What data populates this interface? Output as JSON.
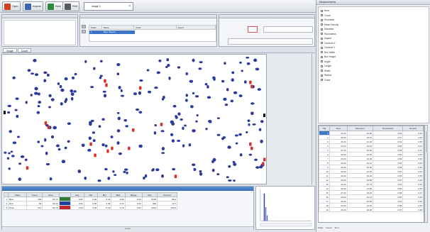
{
  "toolbar": {
    "buttons": [
      {
        "label": "Open",
        "color": "#d04020"
      },
      {
        "label": "Acquire",
        "color": "#3a66b0"
      },
      {
        "label": "Save",
        "color": "#2e8b3a"
      },
      {
        "label": "Print",
        "color": "#5a5a5a"
      }
    ],
    "document_tab": "Image 1",
    "close_glyph": "×"
  },
  "image_tabs": [
    "Image",
    "Count"
  ],
  "right_panel": {
    "header": "Measurements",
    "items": [
      "Area",
      "Count",
      "Perimeter",
      "Mean Density",
      "Diameter",
      "Roundness",
      "Aspect",
      "Centroid X",
      "Centroid Y",
      "Box Width",
      "Box Height",
      "Angle",
      "Length",
      "Width",
      "Radius",
      "Class"
    ]
  },
  "meas_table": {
    "columns": [
      "Obj",
      "Area",
      "Perimeter",
      "Roundness",
      "Density"
    ],
    "rows": [
      [
        "1",
        "31.00",
        "19.90",
        "0.83",
        "0.52"
      ],
      [
        "2",
        "28.00",
        "18.70",
        "0.87",
        "0.49"
      ],
      [
        "3",
        "35.00",
        "21.40",
        "0.81",
        "0.55"
      ],
      [
        "4",
        "30.00",
        "19.20",
        "0.85",
        "0.51"
      ],
      [
        "5",
        "27.00",
        "18.30",
        "0.88",
        "0.47"
      ],
      [
        "6",
        "33.00",
        "20.60",
        "0.82",
        "0.53"
      ],
      [
        "7",
        "29.00",
        "19.00",
        "0.86",
        "0.50"
      ],
      [
        "8",
        "32.00",
        "20.10",
        "0.84",
        "0.52"
      ],
      [
        "9",
        "26.00",
        "18.00",
        "0.89",
        "0.46"
      ],
      [
        "10",
        "34.00",
        "21.00",
        "0.81",
        "0.54"
      ],
      [
        "11",
        "30.00",
        "19.40",
        "0.85",
        "0.50"
      ],
      [
        "12",
        "28.00",
        "18.80",
        "0.87",
        "0.48"
      ],
      [
        "13",
        "31.00",
        "19.70",
        "0.84",
        "0.51"
      ],
      [
        "14",
        "36.00",
        "21.80",
        "0.80",
        "0.56"
      ],
      [
        "15",
        "27.00",
        "18.40",
        "0.88",
        "0.47"
      ],
      [
        "16",
        "29.00",
        "19.10",
        "0.86",
        "0.49"
      ],
      [
        "17",
        "33.00",
        "20.50",
        "0.83",
        "0.53"
      ],
      [
        "18",
        "30.00",
        "19.30",
        "0.85",
        "0.50"
      ],
      [
        "19",
        "28.00",
        "18.90",
        "0.87",
        "0.48"
      ]
    ],
    "footer": [
      "Class",
      "Count",
      "Sum"
    ]
  },
  "p2_grid": {
    "headers": [
      "Class",
      "Name",
      "Color",
      "Count"
    ],
    "row": [
      "1",
      "Blue Objects",
      "",
      ""
    ]
  },
  "class_table": {
    "columns": [
      "",
      "Class",
      "Count",
      "Area",
      "Avg",
      "Std",
      "Min",
      "Max",
      "Range",
      "Sum",
      "Percent"
    ],
    "rows": [
      {
        "id": "1",
        "name": "Blue",
        "count": "182",
        "area": "30.10",
        "avg": "0.52",
        "std": "0.04",
        "min": "0.41",
        "max": "0.63",
        "range": "0.22",
        "sum": "5478",
        "pct": "86.3"
      },
      {
        "id": "2",
        "name": "Red",
        "count": "29",
        "area": "34.20",
        "avg": "0.61",
        "std": "0.05",
        "min": "0.49",
        "max": "0.72",
        "range": "0.23",
        "sum": "992",
        "pct": "13.7"
      },
      {
        "id": "3",
        "name": "Total",
        "count": "211",
        "area": "30.70",
        "avg": "0.53",
        "std": "0.05",
        "min": "0.41",
        "max": "0.72",
        "range": "0.31",
        "sum": "6470",
        "pct": "100.0"
      }
    ],
    "swatches": [
      "#2e7d32",
      "#1e3fa0",
      "#c0282e"
    ],
    "status": "Count"
  },
  "colors": {
    "blue_object": "#2b3a9c",
    "red_object": "#d8312a",
    "dark_object": "#111111",
    "histogram_bar": "#2a3bb0"
  }
}
